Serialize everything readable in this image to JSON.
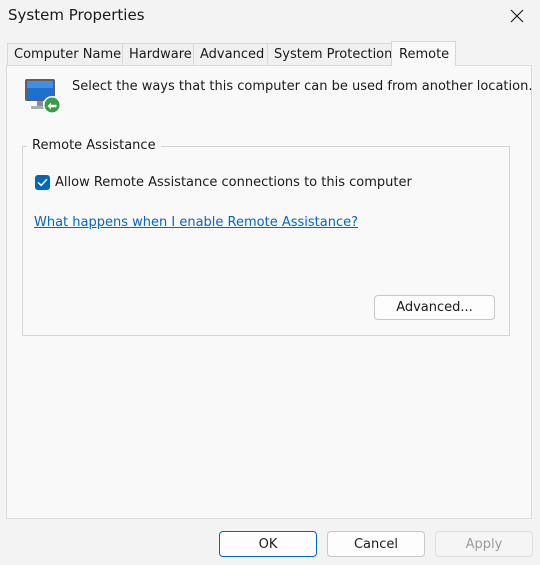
{
  "window": {
    "title": "System Properties"
  },
  "tabs": [
    {
      "label": "Computer Name",
      "active": false
    },
    {
      "label": "Hardware",
      "active": false
    },
    {
      "label": "Advanced",
      "active": false
    },
    {
      "label": "System Protection",
      "active": false
    },
    {
      "label": "Remote",
      "active": true
    }
  ],
  "remote": {
    "intro_text": "Select the ways that this computer can be used from another location.",
    "intro_icon": "remote-computer-icon",
    "assistance_group": {
      "title": "Remote Assistance",
      "allow_checkbox": {
        "label": "Allow Remote Assistance connections to this computer",
        "checked": true
      },
      "help_link": "What happens when I enable Remote Assistance?",
      "advanced_button": "Advanced..."
    }
  },
  "footer": {
    "ok": "OK",
    "cancel": "Cancel",
    "apply": "Apply",
    "apply_enabled": false
  },
  "colors": {
    "accent": "#0067c0",
    "link": "#0066cc"
  }
}
